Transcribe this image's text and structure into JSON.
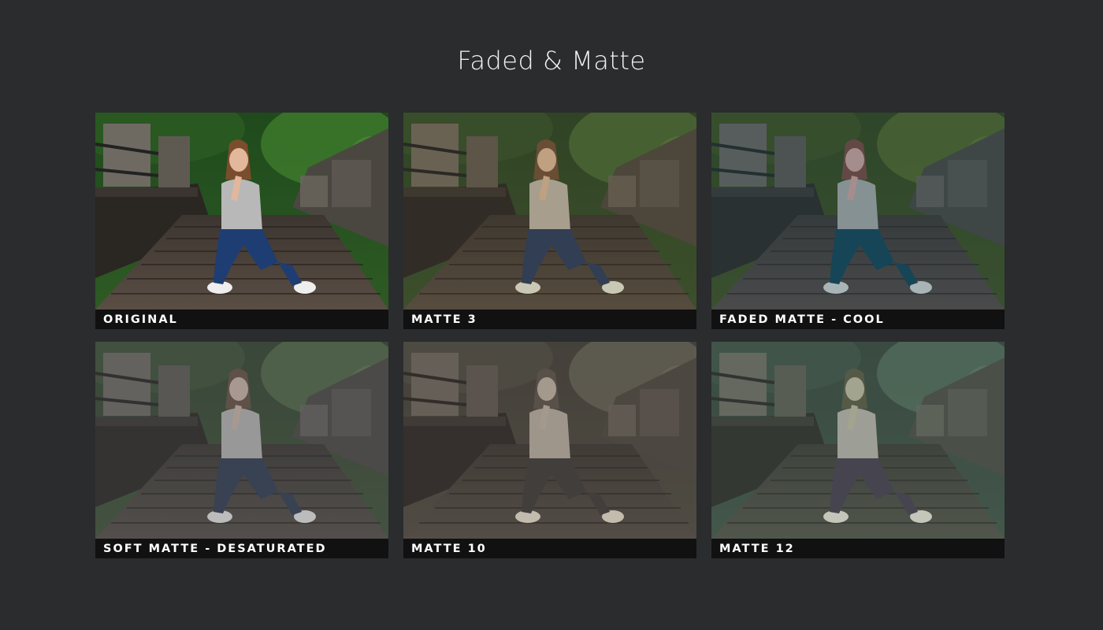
{
  "header": {
    "title": "Faded & Matte"
  },
  "presets": [
    {
      "label": "ORIGINAL",
      "filter": "original"
    },
    {
      "label": "MATTE 3",
      "filter": "matte3"
    },
    {
      "label": "FADED MATTE - COOL",
      "filter": "cool"
    },
    {
      "label": "SOFT MATTE - DESATURATED",
      "filter": "desat"
    },
    {
      "label": "MATTE 10",
      "filter": "matte10"
    },
    {
      "label": "MATTE 12",
      "filter": "matte12"
    }
  ],
  "colors": {
    "background": "#2b2c2e",
    "label_bar": "#111111",
    "label_text": "#ffffff",
    "title_text": "#f2f2f2"
  }
}
